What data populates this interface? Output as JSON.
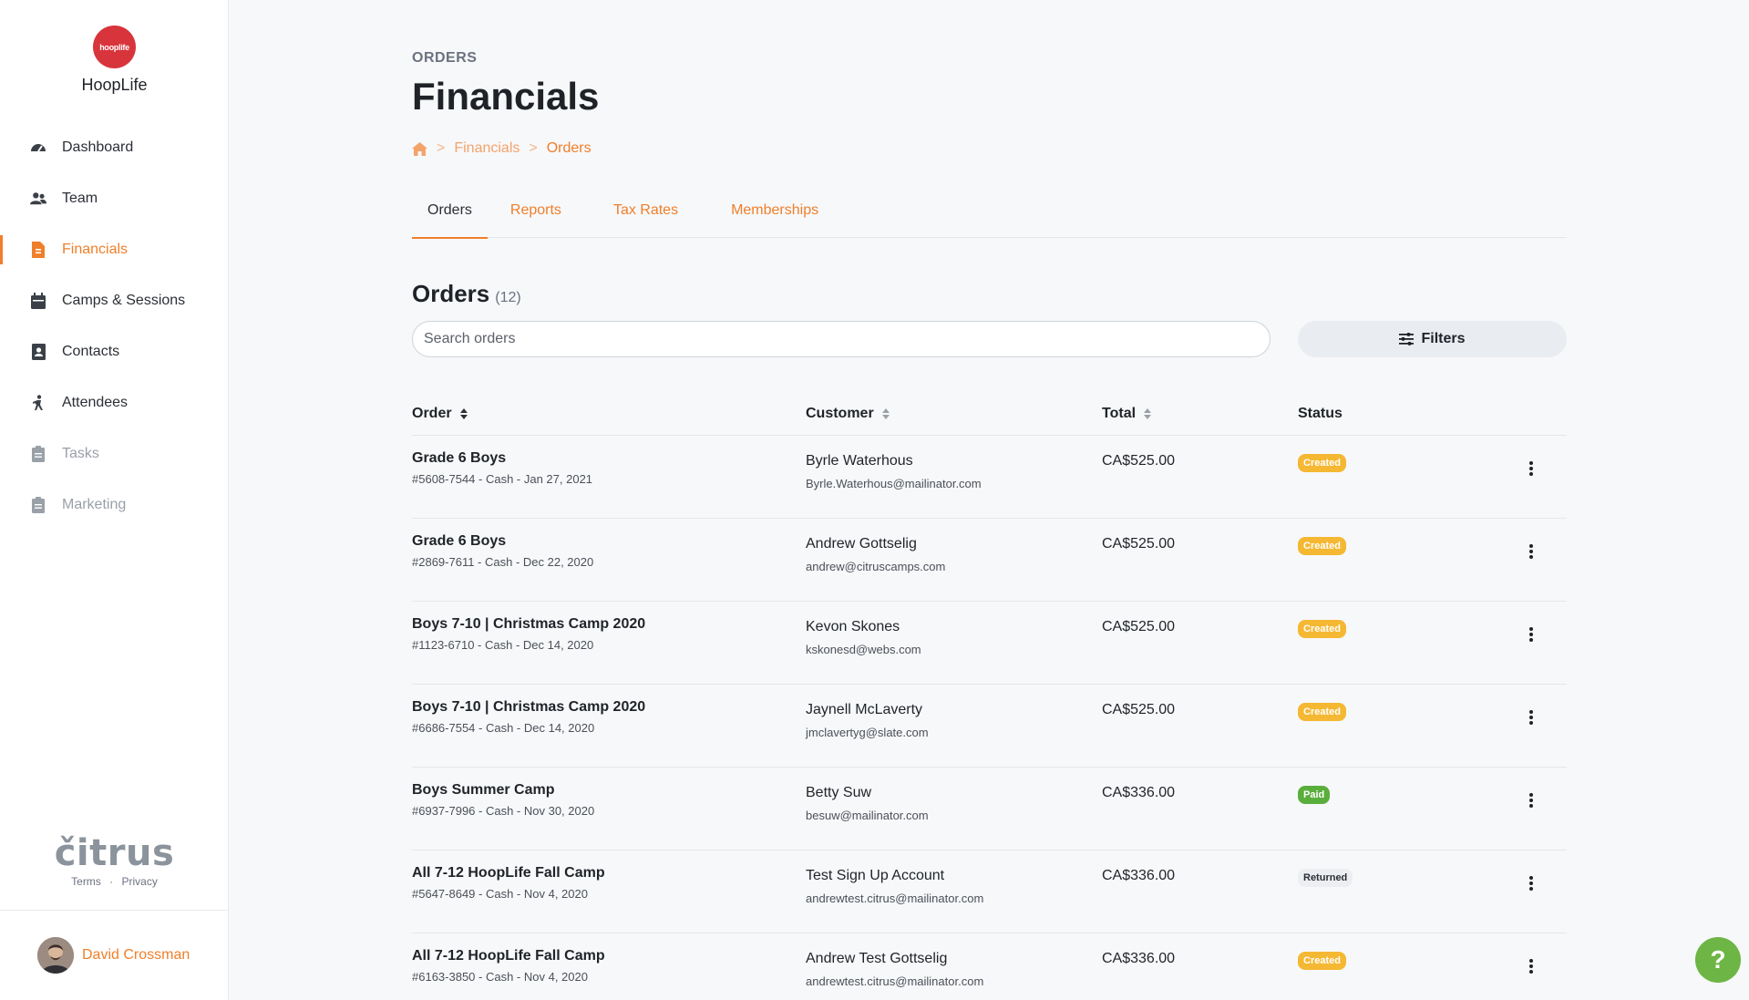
{
  "sidebar": {
    "org_logo_text": "hooplife",
    "org_name": "HoopLife",
    "items": [
      {
        "label": "Dashboard",
        "icon": "dashboard-icon"
      },
      {
        "label": "Team",
        "icon": "team-icon"
      },
      {
        "label": "Financials",
        "icon": "financials-icon"
      },
      {
        "label": "Camps & Sessions",
        "icon": "calendar-icon"
      },
      {
        "label": "Contacts",
        "icon": "contacts-icon"
      },
      {
        "label": "Attendees",
        "icon": "attendees-icon"
      },
      {
        "label": "Tasks",
        "icon": "clipboard-icon"
      },
      {
        "label": "Marketing",
        "icon": "clipboard-icon"
      }
    ],
    "active_item": "Financials",
    "brand": "čitrus",
    "terms_label": "Terms",
    "dot": "·",
    "privacy_label": "Privacy",
    "user_name": "David Crossman"
  },
  "header": {
    "eyebrow": "ORDERS",
    "title": "Financials",
    "breadcrumb": {
      "sep": ">",
      "items": [
        "Financials",
        "Orders"
      ]
    }
  },
  "tabs": [
    {
      "label": "Orders",
      "active": true
    },
    {
      "label": "Reports",
      "active": false
    },
    {
      "label": "Tax Rates",
      "active": false
    },
    {
      "label": "Memberships",
      "active": false
    }
  ],
  "orders": {
    "title": "Orders",
    "count": "(12)",
    "search_placeholder": "Search orders",
    "filters_label": "Filters",
    "columns": {
      "order": "Order",
      "customer": "Customer",
      "total": "Total",
      "status": "Status"
    },
    "rows": [
      {
        "name": "Grade 6 Boys",
        "meta": "#5608-7544 - Cash - Jan 27, 2021",
        "customer": "Byrle Waterhous",
        "email": "Byrle.Waterhous@mailinator.com",
        "total": "CA$525.00",
        "status": "Created"
      },
      {
        "name": "Grade 6 Boys",
        "meta": "#2869-7611 - Cash - Dec 22, 2020",
        "customer": "Andrew Gottselig",
        "email": "andrew@citruscamps.com",
        "total": "CA$525.00",
        "status": "Created"
      },
      {
        "name": "Boys 7-10 | Christmas Camp 2020",
        "meta": "#1123-6710 - Cash - Dec 14, 2020",
        "customer": "Kevon Skones",
        "email": "kskonesd@webs.com",
        "total": "CA$525.00",
        "status": "Created"
      },
      {
        "name": "Boys 7-10 | Christmas Camp 2020",
        "meta": "#6686-7554 - Cash - Dec 14, 2020",
        "customer": "Jaynell McLaverty",
        "email": "jmclavertyg@slate.com",
        "total": "CA$525.00",
        "status": "Created"
      },
      {
        "name": "Boys Summer Camp",
        "meta": "#6937-7996 - Cash - Nov 30, 2020",
        "customer": "Betty Suw",
        "email": "besuw@mailinator.com",
        "total": "CA$336.00",
        "status": "Paid"
      },
      {
        "name": "All 7-12 HoopLife Fall Camp",
        "meta": "#5647-8649 - Cash - Nov 4, 2020",
        "customer": "Test Sign Up Account",
        "email": "andrewtest.citrus@mailinator.com",
        "total": "CA$336.00",
        "status": "Returned"
      },
      {
        "name": "All 7-12 HoopLife Fall Camp",
        "meta": "#6163-3850 - Cash - Nov 4, 2020",
        "customer": "Andrew Test Gottselig",
        "email": "andrewtest.citrus@mailinator.com",
        "total": "CA$336.00",
        "status": "Created"
      }
    ]
  },
  "help_label": "?",
  "colors": {
    "accent": "#ef7f2a",
    "created": "#f5b833",
    "paid": "#5aae3c",
    "returned": "#eceef1",
    "help": "#6db545",
    "logo": "#d8343c"
  }
}
